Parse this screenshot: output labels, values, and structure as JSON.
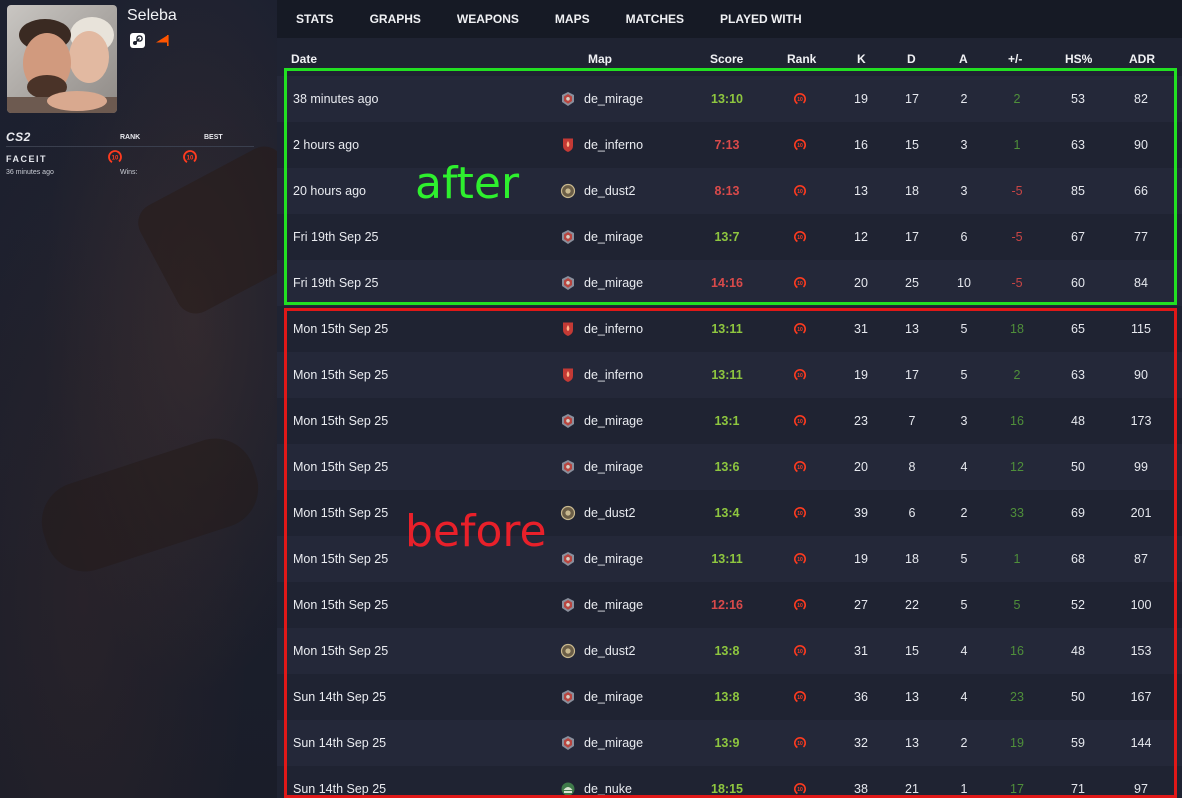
{
  "profile": {
    "name": "Seleba",
    "platforms": [
      "steam-icon",
      "faceit-icon"
    ]
  },
  "side": {
    "game_logo": "CS2",
    "rank_label": "RANK",
    "best_label": "BEST",
    "faceit_logo": "FACEIT",
    "faceit_level": "10",
    "best_level": "10",
    "last_played": "36 minutes ago",
    "wins_label": "Wins:"
  },
  "nav": [
    "STATS",
    "GRAPHS",
    "WEAPONS",
    "MAPS",
    "MATCHES",
    "PLAYED WITH"
  ],
  "table": {
    "headers": {
      "date": "Date",
      "map": "Map",
      "score": "Score",
      "rank": "Rank",
      "k": "K",
      "d": "D",
      "a": "A",
      "pm": "+/-",
      "hs": "HS%",
      "adr": "ADR"
    },
    "rows": [
      {
        "date": "38 minutes ago",
        "map": "de_mirage",
        "score": "13:10",
        "result": "win",
        "k": "19",
        "d": "17",
        "a": "2",
        "pm": "2",
        "hs": "53",
        "adr": "82"
      },
      {
        "date": "2 hours ago",
        "map": "de_inferno",
        "score": "7:13",
        "result": "loss",
        "k": "16",
        "d": "15",
        "a": "3",
        "pm": "1",
        "hs": "63",
        "adr": "90"
      },
      {
        "date": "20 hours ago",
        "map": "de_dust2",
        "score": "8:13",
        "result": "loss",
        "k": "13",
        "d": "18",
        "a": "3",
        "pm": "-5",
        "hs": "85",
        "adr": "66"
      },
      {
        "date": "Fri 19th Sep 25",
        "map": "de_mirage",
        "score": "13:7",
        "result": "win",
        "k": "12",
        "d": "17",
        "a": "6",
        "pm": "-5",
        "hs": "67",
        "adr": "77"
      },
      {
        "date": "Fri 19th Sep 25",
        "map": "de_mirage",
        "score": "14:16",
        "result": "loss",
        "k": "20",
        "d": "25",
        "a": "10",
        "pm": "-5",
        "hs": "60",
        "adr": "84"
      },
      {
        "date": "Mon 15th Sep 25",
        "map": "de_inferno",
        "score": "13:11",
        "result": "win",
        "k": "31",
        "d": "13",
        "a": "5",
        "pm": "18",
        "hs": "65",
        "adr": "115"
      },
      {
        "date": "Mon 15th Sep 25",
        "map": "de_inferno",
        "score": "13:11",
        "result": "win",
        "k": "19",
        "d": "17",
        "a": "5",
        "pm": "2",
        "hs": "63",
        "adr": "90"
      },
      {
        "date": "Mon 15th Sep 25",
        "map": "de_mirage",
        "score": "13:1",
        "result": "win",
        "k": "23",
        "d": "7",
        "a": "3",
        "pm": "16",
        "hs": "48",
        "adr": "173"
      },
      {
        "date": "Mon 15th Sep 25",
        "map": "de_mirage",
        "score": "13:6",
        "result": "win",
        "k": "20",
        "d": "8",
        "a": "4",
        "pm": "12",
        "hs": "50",
        "adr": "99"
      },
      {
        "date": "Mon 15th Sep 25",
        "map": "de_dust2",
        "score": "13:4",
        "result": "win",
        "k": "39",
        "d": "6",
        "a": "2",
        "pm": "33",
        "hs": "69",
        "adr": "201"
      },
      {
        "date": "Mon 15th Sep 25",
        "map": "de_mirage",
        "score": "13:11",
        "result": "win",
        "k": "19",
        "d": "18",
        "a": "5",
        "pm": "1",
        "hs": "68",
        "adr": "87"
      },
      {
        "date": "Mon 15th Sep 25",
        "map": "de_mirage",
        "score": "12:16",
        "result": "loss",
        "k": "27",
        "d": "22",
        "a": "5",
        "pm": "5",
        "hs": "52",
        "adr": "100"
      },
      {
        "date": "Mon 15th Sep 25",
        "map": "de_dust2",
        "score": "13:8",
        "result": "win",
        "k": "31",
        "d": "15",
        "a": "4",
        "pm": "16",
        "hs": "48",
        "adr": "153"
      },
      {
        "date": "Sun 14th Sep 25",
        "map": "de_mirage",
        "score": "13:8",
        "result": "win",
        "k": "36",
        "d": "13",
        "a": "4",
        "pm": "23",
        "hs": "50",
        "adr": "167"
      },
      {
        "date": "Sun 14th Sep 25",
        "map": "de_mirage",
        "score": "13:9",
        "result": "win",
        "k": "32",
        "d": "13",
        "a": "2",
        "pm": "19",
        "hs": "59",
        "adr": "144"
      },
      {
        "date": "Sun 14th Sep 25",
        "map": "de_nuke",
        "score": "18:15",
        "result": "win",
        "k": "38",
        "d": "21",
        "a": "1",
        "pm": "17",
        "hs": "71",
        "adr": "97"
      }
    ]
  },
  "annotations": {
    "after": "after",
    "before": "before",
    "after_color": "#22e022",
    "before_color": "#e01818"
  },
  "colors": {
    "win": "#8ec63f",
    "loss": "#d94a4a",
    "faceit_orange": "#ff5500"
  }
}
